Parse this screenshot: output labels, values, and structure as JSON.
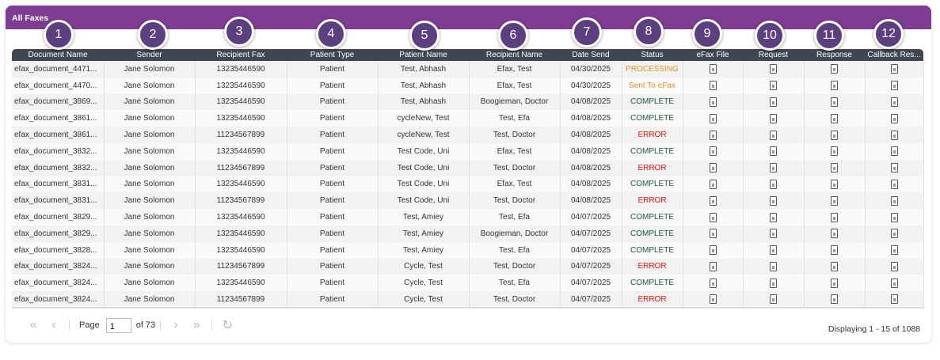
{
  "panel": {
    "title": "All Faxes"
  },
  "columns": [
    "Document Name",
    "Sender",
    "Recipient Fax",
    "Patient Type",
    "Patient Name",
    "Recipient Name",
    "Date Send",
    "Status",
    "eFax File",
    "Request",
    "Response",
    "Callback Res..."
  ],
  "badges": [
    "1",
    "2",
    "3",
    "4",
    "5",
    "6",
    "7",
    "8",
    "9",
    "10",
    "11",
    "12"
  ],
  "rows": [
    [
      "efax_document_4471...",
      "Jane Solomon",
      "13235446590",
      "Patient",
      "Test, Abhash",
      "Efax, Test",
      "04/30/2025",
      "PROCESSING"
    ],
    [
      "efax_document_4470...",
      "Jane Solomon",
      "13235446590",
      "Patient",
      "Test, Abhash",
      "Efax, Test",
      "04/30/2025",
      "Sent To eFax"
    ],
    [
      "efax_document_3869...",
      "Jane Solomon",
      "13235446590",
      "Patient",
      "Test, Abhash",
      "Boogieman, Doctor",
      "04/08/2025",
      "COMPLETE"
    ],
    [
      "efax_document_3861...",
      "Jane Solomon",
      "13235446590",
      "Patient",
      "cycleNew, Test",
      "Test, Efa",
      "04/08/2025",
      "COMPLETE"
    ],
    [
      "efax_document_3861...",
      "Jane Solomon",
      "11234567899",
      "Patient",
      "cycleNew, Test",
      "Test, Doctor",
      "04/08/2025",
      "ERROR"
    ],
    [
      "efax_document_3832...",
      "Jane Solomon",
      "13235446590",
      "Patient",
      "Test Code, Uni",
      "Efax, Test",
      "04/08/2025",
      "COMPLETE"
    ],
    [
      "efax_document_3832...",
      "Jane Solomon",
      "11234567899",
      "Patient",
      "Test Code, Uni",
      "Test, Doctor",
      "04/08/2025",
      "ERROR"
    ],
    [
      "efax_document_3831...",
      "Jane Solomon",
      "13235446590",
      "Patient",
      "Test Code, Uni",
      "Efax, Test",
      "04/08/2025",
      "COMPLETE"
    ],
    [
      "efax_document_3831...",
      "Jane Solomon",
      "11234567899",
      "Patient",
      "Test Code, Uni",
      "Test, Doctor",
      "04/08/2025",
      "ERROR"
    ],
    [
      "efax_document_3829...",
      "Jane Solomon",
      "13235446590",
      "Patient",
      "Test, Amiey",
      "Test, Efa",
      "04/07/2025",
      "COMPLETE"
    ],
    [
      "efax_document_3829...",
      "Jane Solomon",
      "13235446590",
      "Patient",
      "Test, Amiey",
      "Boogieman, Doctor",
      "04/07/2025",
      "COMPLETE"
    ],
    [
      "efax_document_3828...",
      "Jane Solomon",
      "13235446590",
      "Patient",
      "Test, Amiey",
      "Test, Efa",
      "04/07/2025",
      "COMPLETE"
    ],
    [
      "efax_document_3824...",
      "Jane Solomon",
      "11234567899",
      "Patient",
      "Cycle, Test",
      "Test, Doctor",
      "04/07/2025",
      "ERROR"
    ],
    [
      "efax_document_3824...",
      "Jane Solomon",
      "13235446590",
      "Patient",
      "Cycle, Test",
      "Test, Efa",
      "04/07/2025",
      "COMPLETE"
    ],
    [
      "efax_document_3824...",
      "Jane Solomon",
      "11234567899",
      "Patient",
      "Cycle, Test",
      "Test, Doctor",
      "04/07/2025",
      "ERROR"
    ]
  ],
  "pager": {
    "page_label": "Page",
    "page_value": "1",
    "of_label": "of 73",
    "display": "Displaying 1 - 15 of 1088"
  },
  "colors": {
    "header": "#7e3c92",
    "table_head": "#3e4651",
    "badge": "#5b3f7f",
    "processing": "#f0902a",
    "complete": "#1d5a3a",
    "error": "#f01010"
  },
  "icons": {
    "file": "document-icon",
    "first": "double-chevron-left-icon",
    "prev": "chevron-left-icon",
    "next": "chevron-right-icon",
    "last": "double-chevron-right-icon",
    "refresh": "refresh-icon"
  }
}
